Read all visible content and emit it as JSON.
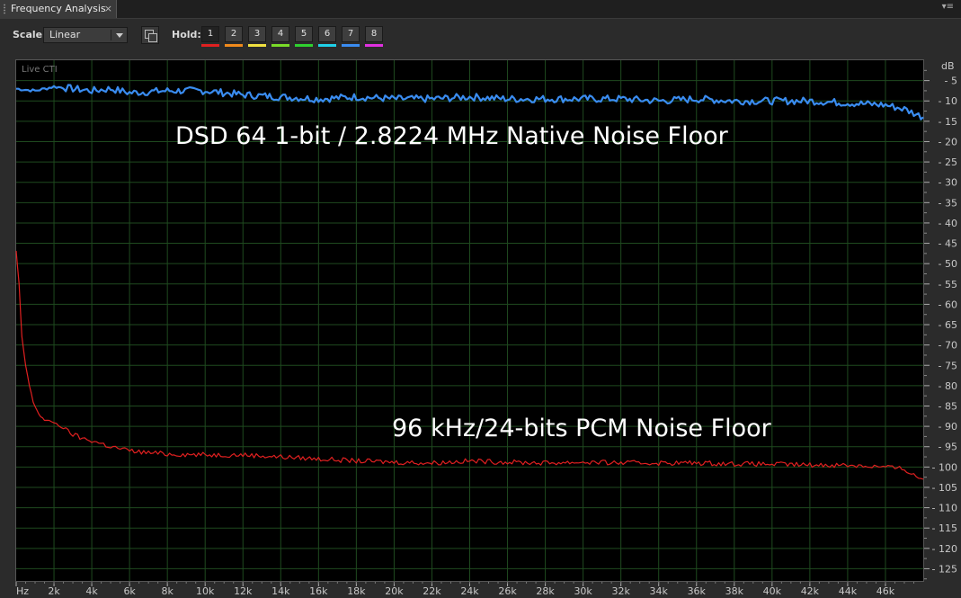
{
  "tab": {
    "title": "Frequency Analysis",
    "close": "×"
  },
  "panel_menu_icon": "▾≡",
  "toolbar": {
    "scale_label": "Scale:",
    "scale_value": "Linear",
    "hold_label": "Hold:",
    "hold_buttons": [
      "1",
      "2",
      "3",
      "4",
      "5",
      "6",
      "7",
      "8"
    ],
    "hold_colors": [
      "#e02020",
      "#f08a1c",
      "#f0e040",
      "#7adc28",
      "#2fd02f",
      "#1fd0e8",
      "#3a8cf0",
      "#e030e0"
    ]
  },
  "live_cti": "Live CTI",
  "annotations": {
    "dsd": "DSD 64 1-bit / 2.8224 MHz Native Noise Floor",
    "pcm": "96 kHz/24-bits PCM Noise Floor"
  },
  "chart_data": {
    "type": "line",
    "ylabel": "dB",
    "ylim": [
      -128,
      0
    ],
    "xlim": [
      0,
      48000
    ],
    "grid": true,
    "y_ticks": [
      -5,
      -10,
      -15,
      -20,
      -25,
      -30,
      -35,
      -40,
      -45,
      -50,
      -55,
      -60,
      -65,
      -70,
      -75,
      -80,
      -85,
      -90,
      -95,
      -100,
      -105,
      -110,
      -115,
      -120,
      -125
    ],
    "x_ticks": [
      {
        "label": "Hz",
        "value": 0
      },
      {
        "label": "2k",
        "value": 2000
      },
      {
        "label": "4k",
        "value": 4000
      },
      {
        "label": "6k",
        "value": 6000
      },
      {
        "label": "8k",
        "value": 8000
      },
      {
        "label": "10k",
        "value": 10000
      },
      {
        "label": "12k",
        "value": 12000
      },
      {
        "label": "14k",
        "value": 14000
      },
      {
        "label": "16k",
        "value": 16000
      },
      {
        "label": "18k",
        "value": 18000
      },
      {
        "label": "20k",
        "value": 20000
      },
      {
        "label": "22k",
        "value": 22000
      },
      {
        "label": "24k",
        "value": 24000
      },
      {
        "label": "26k",
        "value": 26000
      },
      {
        "label": "28k",
        "value": 28000
      },
      {
        "label": "30k",
        "value": 30000
      },
      {
        "label": "32k",
        "value": 32000
      },
      {
        "label": "34k",
        "value": 34000
      },
      {
        "label": "36k",
        "value": 36000
      },
      {
        "label": "38k",
        "value": 38000
      },
      {
        "label": "40k",
        "value": 40000
      },
      {
        "label": "42k",
        "value": 42000
      },
      {
        "label": "44k",
        "value": 44000
      },
      {
        "label": "46k",
        "value": 46000
      }
    ],
    "series": [
      {
        "color": "#3a8cf0",
        "x": [
          0,
          1000,
          2000,
          3000,
          4000,
          5000,
          6000,
          8000,
          10000,
          12000,
          14000,
          16000,
          18000,
          20000,
          22000,
          24000,
          26000,
          28000,
          30000,
          32000,
          34000,
          36000,
          38000,
          40000,
          42000,
          44000,
          46000,
          47000,
          48000
        ],
        "y": [
          -7,
          -7.5,
          -6.5,
          -7,
          -7.5,
          -7,
          -8,
          -7.5,
          -7.5,
          -8.5,
          -9,
          -9.5,
          -9,
          -9.5,
          -9.5,
          -9,
          -9.5,
          -9.5,
          -9.5,
          -9.5,
          -10,
          -9.5,
          -10,
          -10,
          -10,
          -10.5,
          -11,
          -12,
          -14
        ]
      },
      {
        "color": "#e02020",
        "x": [
          0,
          150,
          300,
          500,
          700,
          900,
          1200,
          1500,
          2000,
          2500,
          3000,
          3500,
          4000,
          5000,
          6000,
          7000,
          8000,
          10000,
          12000,
          14000,
          16000,
          18000,
          20000,
          22000,
          24000,
          26000,
          28000,
          30000,
          32000,
          34000,
          36000,
          38000,
          40000,
          42000,
          44000,
          46000,
          47000,
          47500,
          48000
        ],
        "y": [
          -47,
          -55,
          -68,
          -75,
          -80,
          -84,
          -87,
          -88.5,
          -89,
          -90.5,
          -92,
          -93,
          -93.5,
          -95,
          -96,
          -96.5,
          -96.8,
          -97,
          -97,
          -97.5,
          -98,
          -98.5,
          -98.8,
          -99,
          -98.5,
          -98.8,
          -99,
          -98.8,
          -99,
          -99,
          -99,
          -99.2,
          -99.3,
          -99.5,
          -99.5,
          -100,
          -100.5,
          -102,
          -103
        ]
      }
    ]
  }
}
